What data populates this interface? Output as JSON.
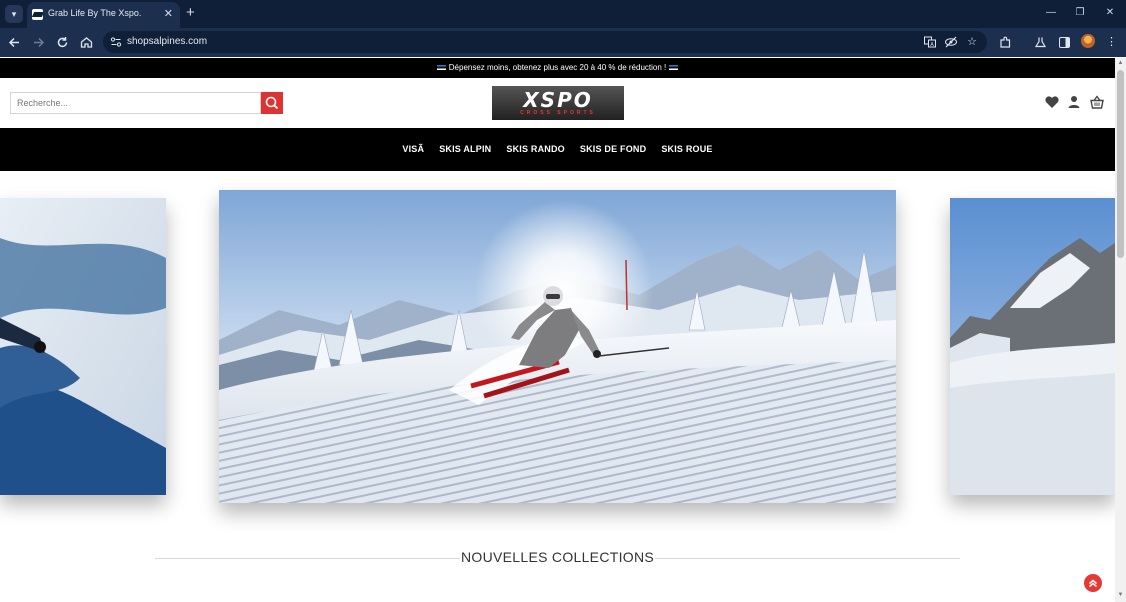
{
  "browser": {
    "tab_title": "Grab Life By The Xspo.",
    "url": "shopsalpines.com"
  },
  "announcement": {
    "text": "Dépensez moins, obtenez plus avec 20 à 40 % de réduction !"
  },
  "header": {
    "search_placeholder": "Recherche...",
    "logo_text": "XSPO",
    "logo_subtext": "CROSS SPORTS"
  },
  "nav": {
    "items": [
      "VISÃ",
      "SKIS ALPIN",
      "SKIS RANDO",
      "SKIS DE FOND",
      "SKIS ROUE"
    ]
  },
  "section": {
    "title": "NOUVELLES COLLECTIONS"
  },
  "colors": {
    "accent": "#dd3333",
    "chrome": "#1c2f4e",
    "chrome_dark": "#0f1f38"
  }
}
